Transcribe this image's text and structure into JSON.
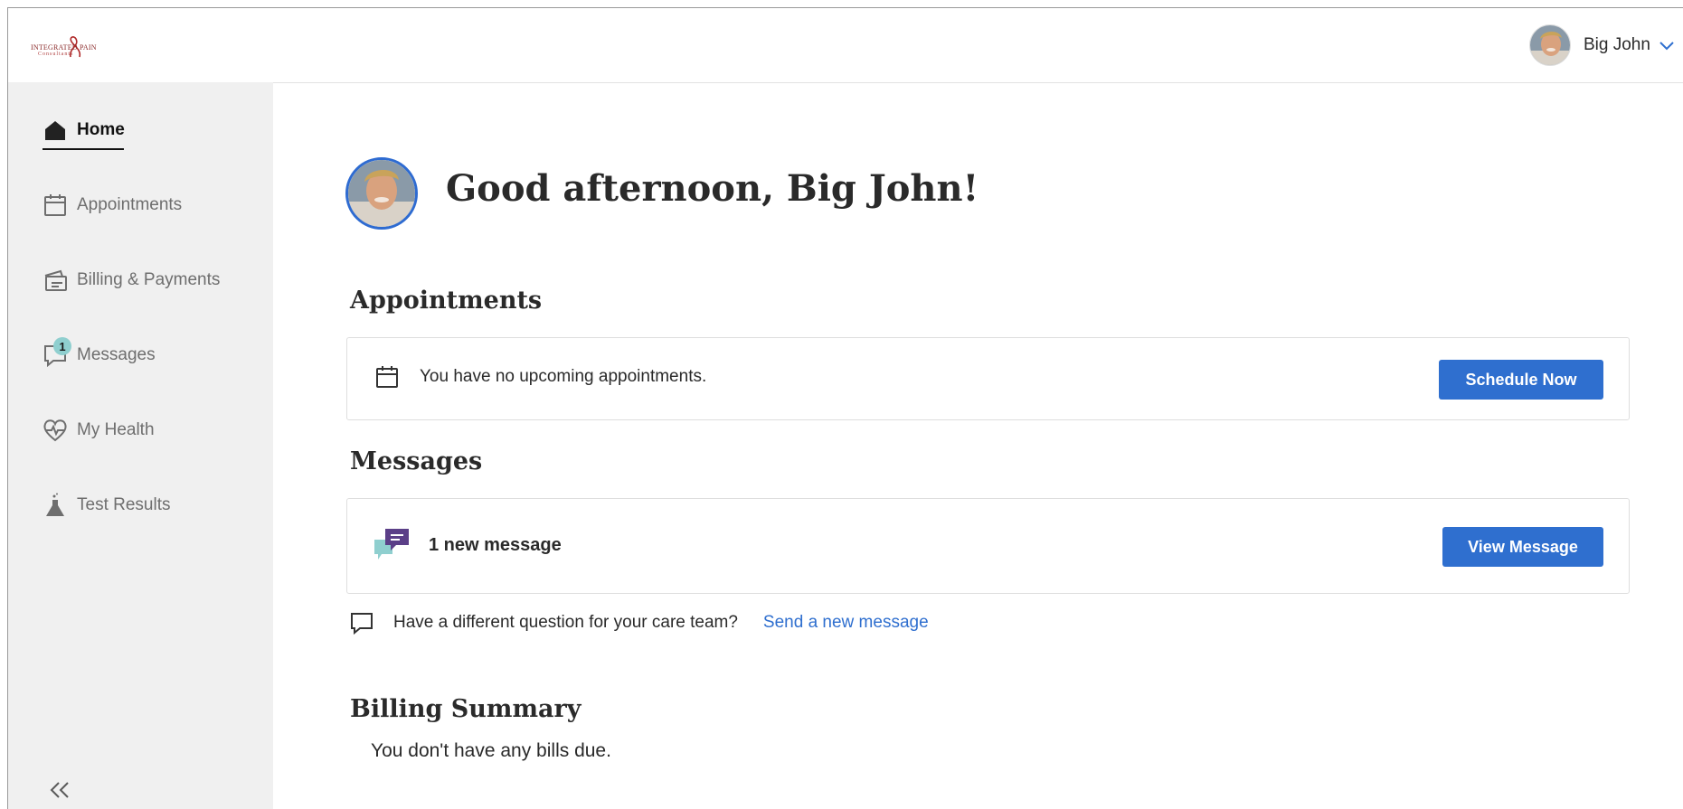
{
  "brand": {
    "logo_line1": "INTEGRATED PAIN",
    "logo_line2": "Consultants",
    "accent": "#2f6fcf"
  },
  "header": {
    "user_name": "Big John",
    "user_menu_icon": "chevron-down-icon"
  },
  "sidebar": {
    "items": [
      {
        "label": "Home",
        "icon": "home-icon",
        "active": true
      },
      {
        "label": "Appointments",
        "icon": "calendar-icon"
      },
      {
        "label": "Billing & Payments",
        "icon": "billing-icon"
      },
      {
        "label": "Messages",
        "icon": "message-icon",
        "badge": "1"
      },
      {
        "label": "My Health",
        "icon": "heart-pulse-icon"
      },
      {
        "label": "Test Results",
        "icon": "flask-icon"
      }
    ],
    "collapse_icon": "double-chevron-left-icon"
  },
  "main": {
    "greeting": "Good afternoon, Big John!",
    "appointments": {
      "title": "Appointments",
      "empty_text": "You have no upcoming appointments.",
      "button_label": "Schedule Now"
    },
    "messages": {
      "title": "Messages",
      "summary": "1 new message",
      "button_label": "View Message",
      "question_text": "Have a different question for your care team?",
      "question_link": "Send a new message"
    },
    "billing": {
      "title": "Billing Summary",
      "summary": "You don't have any bills due."
    }
  }
}
